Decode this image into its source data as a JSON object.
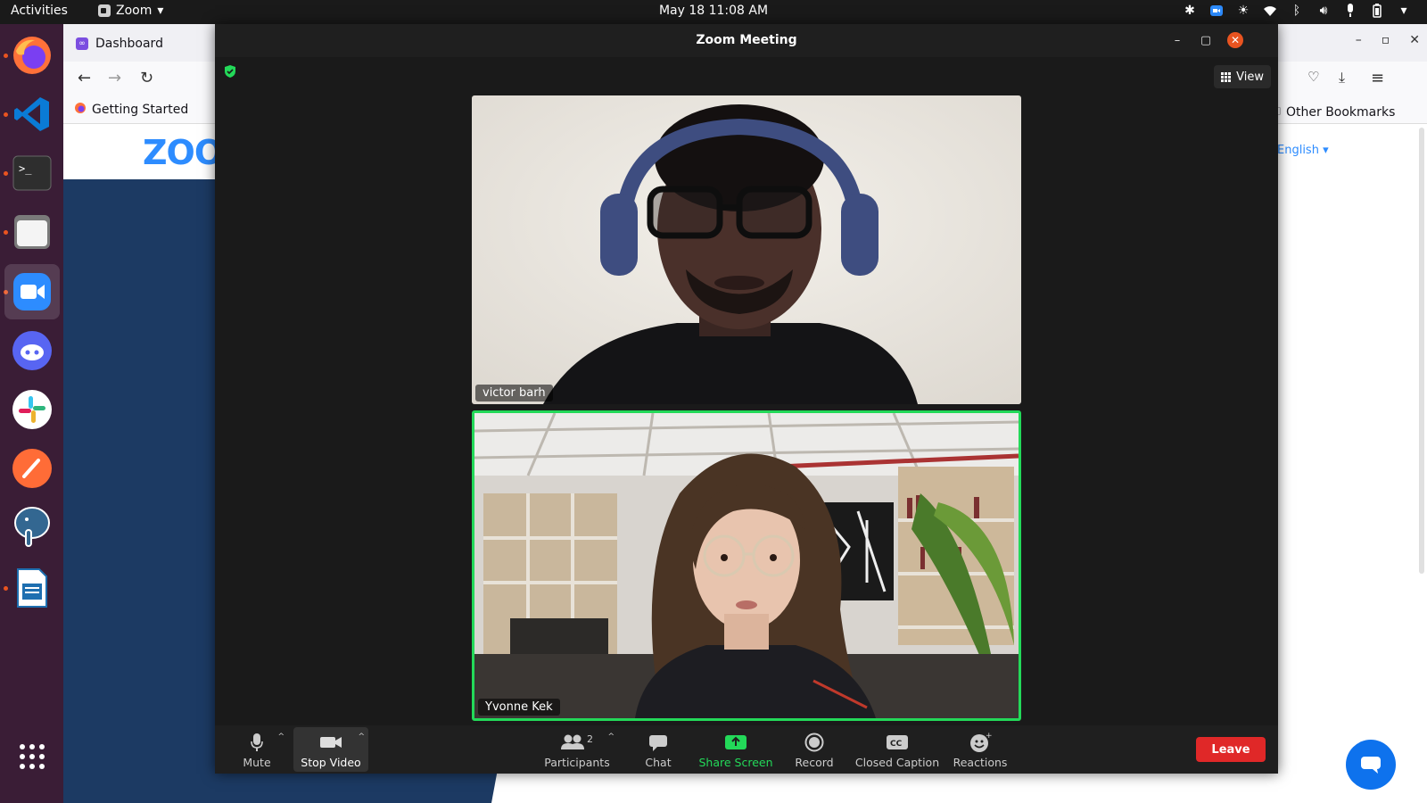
{
  "topbar": {
    "activities": "Activities",
    "app_name": "Zoom",
    "clock": "May 18  11:08 AM"
  },
  "dock": {
    "apps": [
      "firefox-icon",
      "vscode-icon",
      "terminal-icon",
      "files-icon",
      "zoom-icon",
      "discord-icon",
      "slack-icon",
      "postman-icon",
      "postgres-icon",
      "writer-icon",
      "app-grid-icon"
    ]
  },
  "browser": {
    "tab_title": "Dashboard",
    "bookmark_getting_started": "Getting Started",
    "bookmark_other": "Other Bookmarks",
    "page_logo": "ZOOM",
    "language": "English"
  },
  "zoom": {
    "window_title": "Zoom Meeting",
    "view_label": "View",
    "participants": [
      {
        "name": "victor barh"
      },
      {
        "name": "Yvonne Kek"
      }
    ],
    "toolbar": {
      "mute": "Mute",
      "stop_video": "Stop Video",
      "participants": "Participants",
      "participants_count": "2",
      "chat": "Chat",
      "share_screen": "Share Screen",
      "record": "Record",
      "closed_caption": "Closed Caption",
      "reactions": "Reactions",
      "leave": "Leave"
    },
    "colors": {
      "active_speaker_border": "#23d959",
      "share_screen_green": "#23d959",
      "leave_red": "#e02828"
    }
  }
}
